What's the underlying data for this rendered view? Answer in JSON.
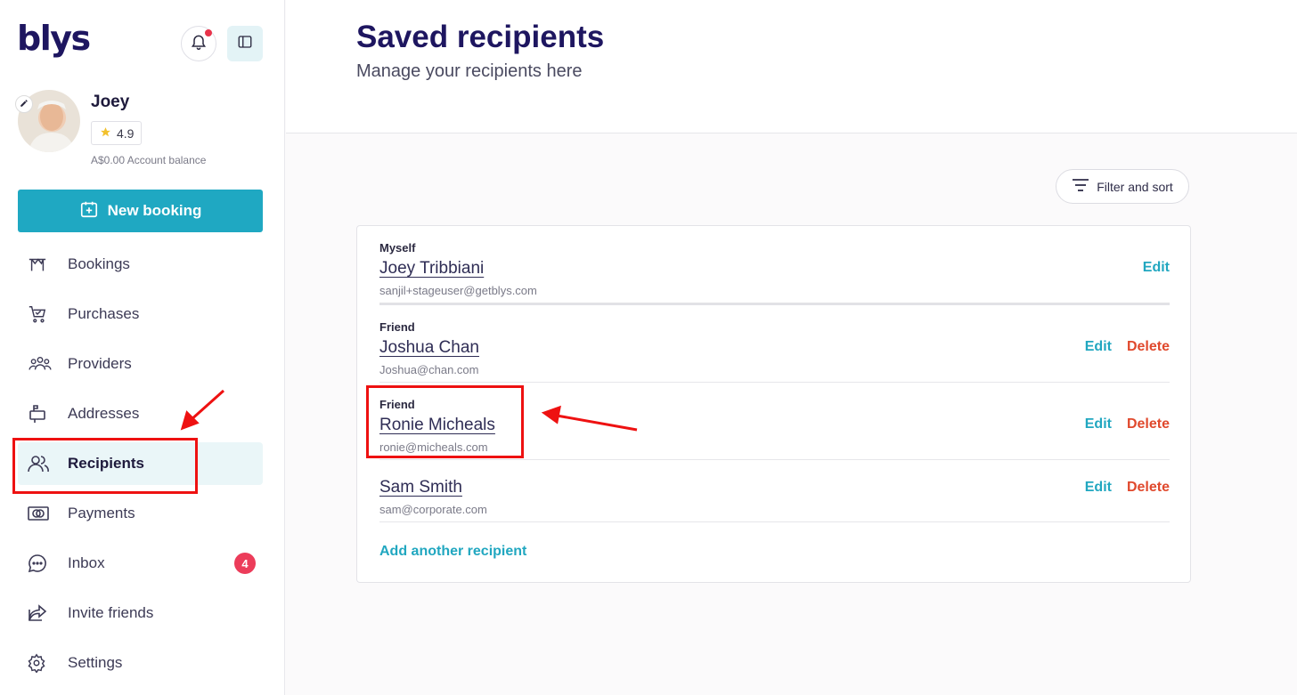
{
  "app": {
    "logo_text": "blys"
  },
  "profile": {
    "name": "Joey",
    "rating": "4.9",
    "balance": "A$0.00 Account balance"
  },
  "sidebar": {
    "new_booking_label": "New booking",
    "items": [
      {
        "label": "Bookings",
        "icon": "bookings-icon"
      },
      {
        "label": "Purchases",
        "icon": "cart-icon"
      },
      {
        "label": "Providers",
        "icon": "providers-icon"
      },
      {
        "label": "Addresses",
        "icon": "mailbox-icon"
      },
      {
        "label": "Recipients",
        "icon": "recipients-icon",
        "active": true
      },
      {
        "label": "Payments",
        "icon": "payment-icon"
      },
      {
        "label": "Inbox",
        "icon": "chat-icon",
        "badge": "4"
      },
      {
        "label": "Invite friends",
        "icon": "share-icon"
      },
      {
        "label": "Settings",
        "icon": "gear-icon"
      }
    ]
  },
  "header": {
    "title": "Saved recipients",
    "subtitle": "Manage your recipients here"
  },
  "toolbar": {
    "filter_label": "Filter and sort"
  },
  "recipients": [
    {
      "relationship": "Myself",
      "name": "Joey Tribbiani",
      "email": "sanjil+stageuser@getblys.com",
      "edit": "Edit"
    },
    {
      "relationship": "Friend",
      "name": "Joshua Chan",
      "email": "Joshua@chan.com",
      "edit": "Edit",
      "delete": "Delete"
    },
    {
      "relationship": "Friend",
      "name": "Ronie Micheals",
      "email": "ronie@micheals.com",
      "edit": "Edit",
      "delete": "Delete"
    },
    {
      "relationship": "",
      "name": "Sam Smith",
      "email": "sam@corporate.com",
      "edit": "Edit",
      "delete": "Delete"
    }
  ],
  "add_recipient_label": "Add another recipient",
  "colors": {
    "brand": "#1e1660",
    "accent": "#1fa8c2",
    "danger": "#e0492d",
    "annotation": "#ee1111"
  }
}
